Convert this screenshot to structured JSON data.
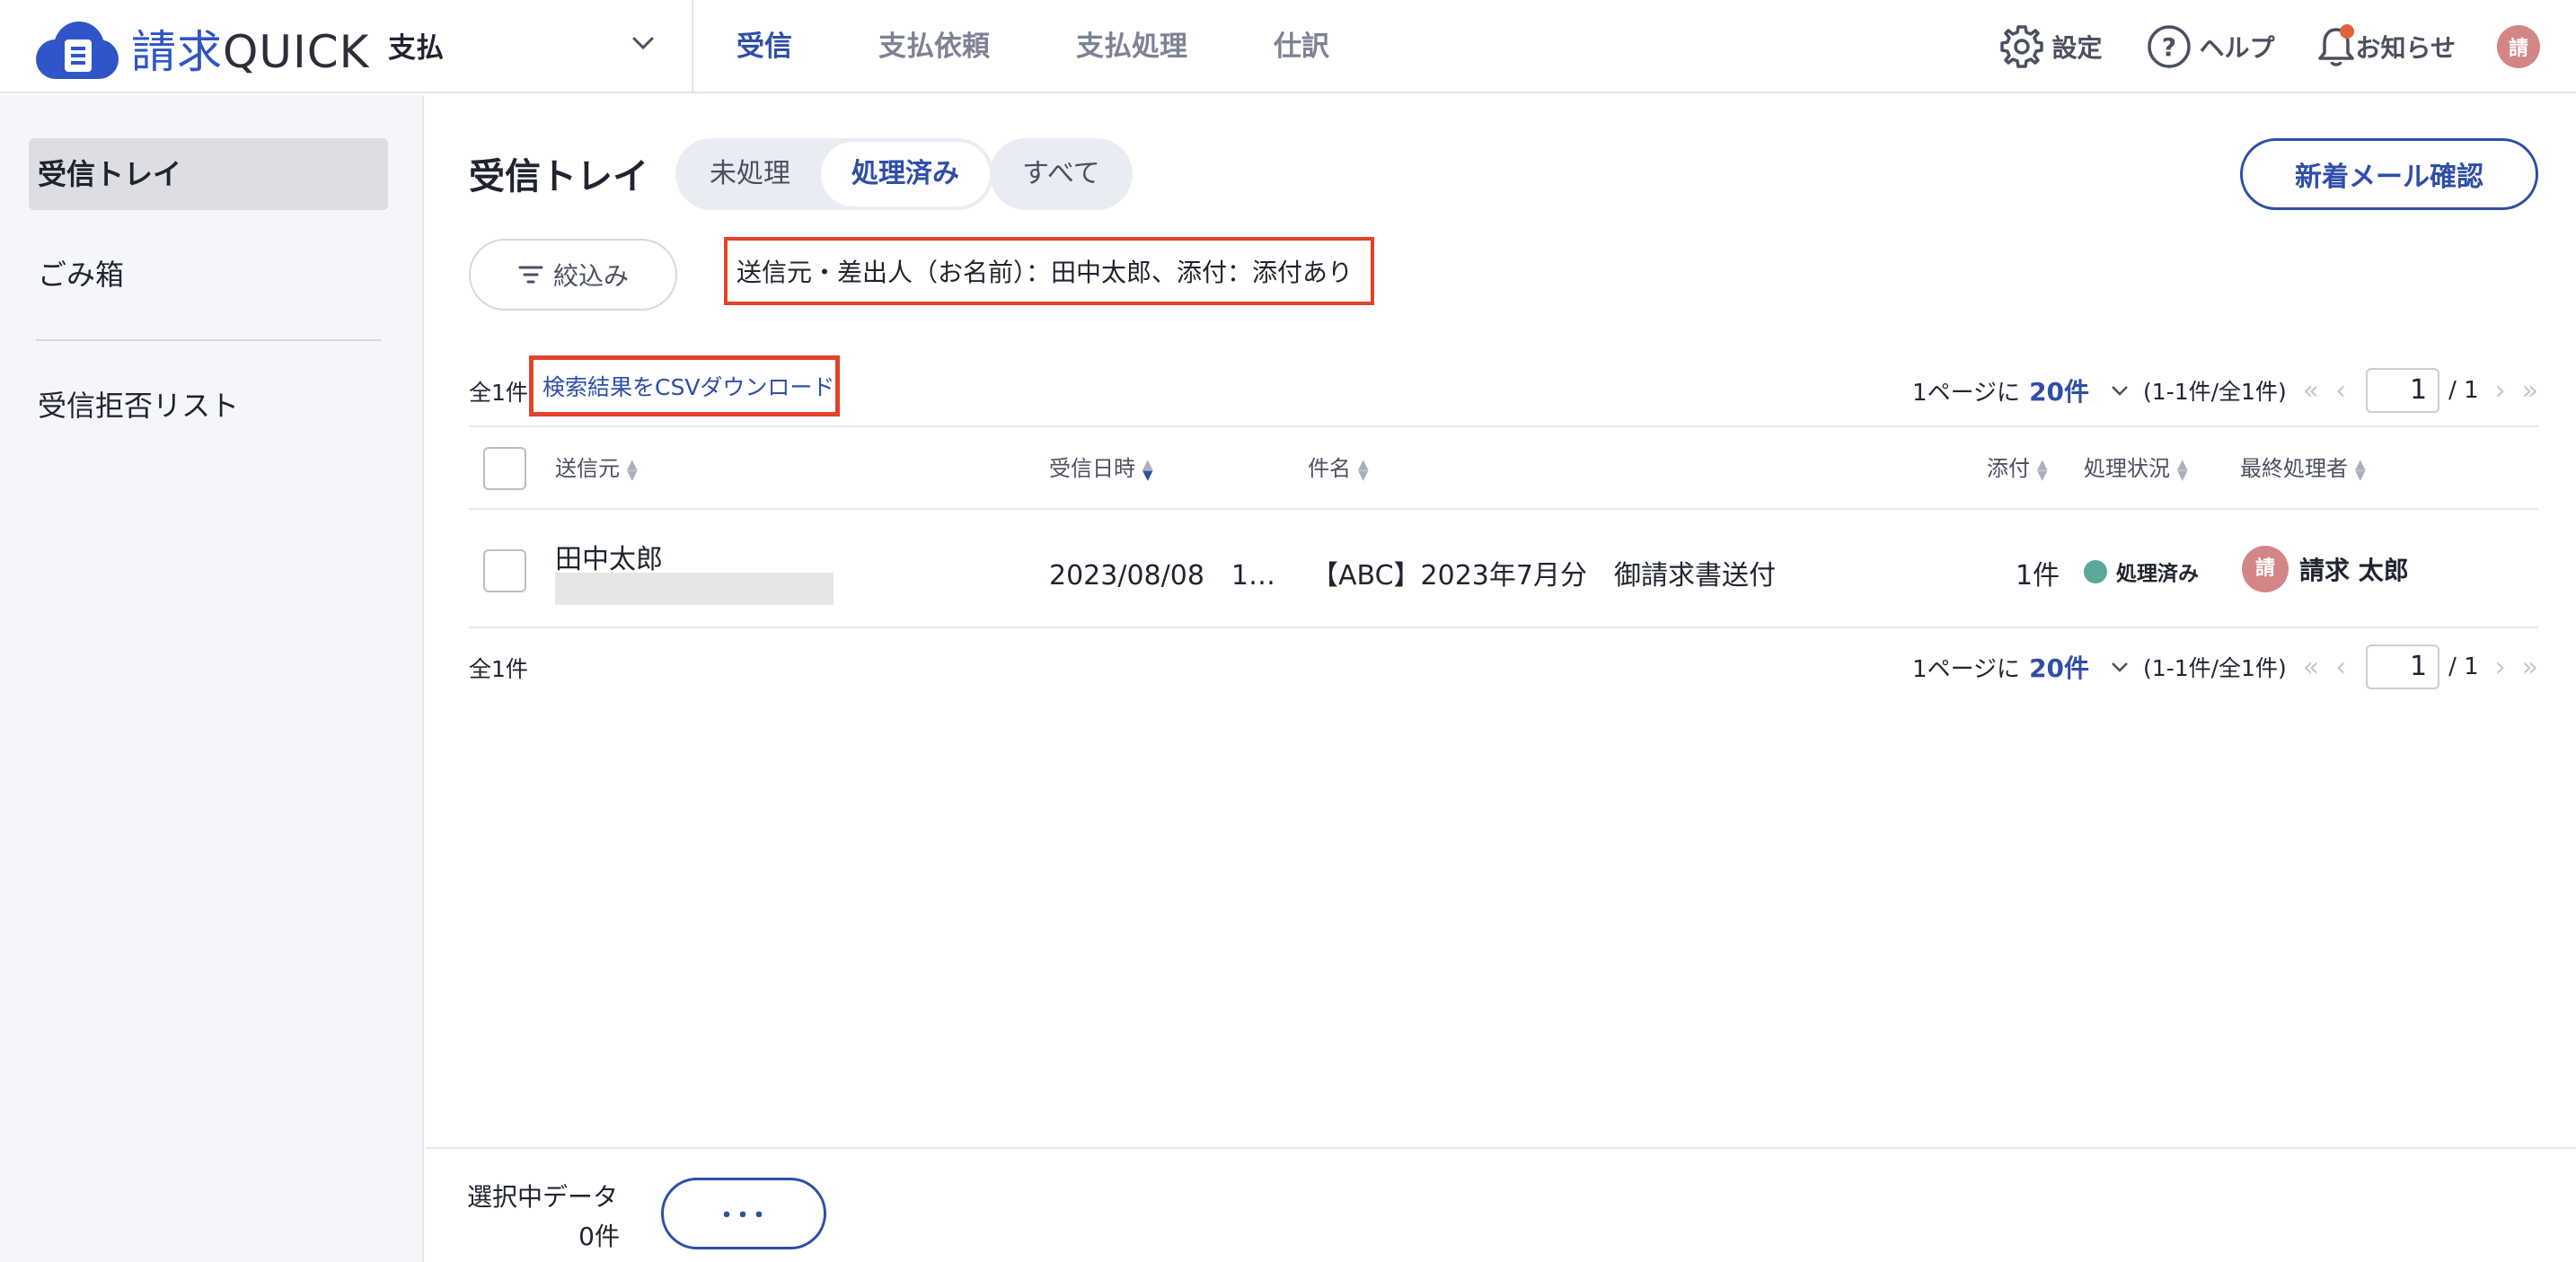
{
  "header": {
    "logo_main": "請求",
    "logo_sub": "QUICK",
    "mode": "支払",
    "nav": [
      "受信",
      "支払依頼",
      "支払処理",
      "仕訳"
    ],
    "settings_label": "設定",
    "help_label": "ヘルプ",
    "notifications_label": "お知らせ",
    "avatar_initial": "請"
  },
  "sidebar": {
    "items": [
      {
        "label": "受信トレイ",
        "active": true
      },
      {
        "label": "ごみ箱",
        "active": false
      },
      {
        "label": "受信拒否リスト",
        "active": false
      }
    ]
  },
  "main": {
    "title": "受信トレイ",
    "tabs": [
      "未処理",
      "処理済み",
      "すべて"
    ],
    "active_tab": "処理済み",
    "new_mail_button": "新着メール確認",
    "filter_button": "絞込み",
    "filter_summary": "送信元・差出人（お名前）：田中太郎、添付：添付あり",
    "count_label": "全1件",
    "csv_link": "検索結果をCSVダウンロード",
    "pager": {
      "per_page_label": "1ページに",
      "per_page_value": "20件",
      "range": "(1-1件/全1件)",
      "current_page": "1",
      "total_pages": "/ 1"
    }
  },
  "table": {
    "columns": [
      "送信元",
      "受信日時",
      "件名",
      "添付",
      "処理状況",
      "最終処理者"
    ],
    "rows": [
      {
        "sender": "田中太郎",
        "received": "2023/08/08　1…",
        "subject": "【ABC】2023年7月分　御請求書送付",
        "attachments": "1件",
        "status": "処理済み",
        "last_handler_initial": "請",
        "last_handler": "請求 太郎"
      }
    ]
  },
  "footer": {
    "selected_label": "選択中データ",
    "selected_count": "0件",
    "more_button": "･･･"
  },
  "colors": {
    "brand": "#2f55c8",
    "accent": "#2f4ea8",
    "highlight_border": "#e2432a",
    "status_done": "#5aa89a",
    "avatar": "#d48585",
    "notification_dot": "#e06238"
  }
}
